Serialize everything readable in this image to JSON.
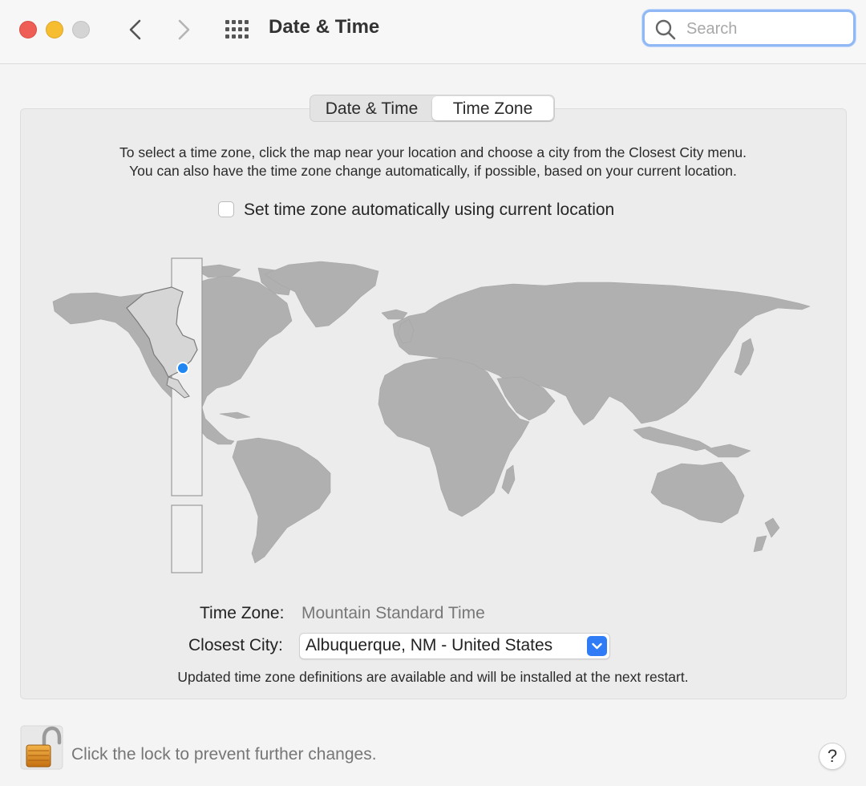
{
  "window": {
    "title": "Date & Time",
    "search_placeholder": "Search"
  },
  "tabs": [
    {
      "label": "Date & Time",
      "selected": false
    },
    {
      "label": "Time Zone",
      "selected": true
    }
  ],
  "instructions": {
    "line1": "To select a time zone, click the map near your location and choose a city from the Closest City menu.",
    "line2": "You can also have the time zone change automatically, if possible, based on your current location."
  },
  "auto_timezone": {
    "label": "Set time zone automatically using current location",
    "checked": false
  },
  "timezone": {
    "label": "Time Zone:",
    "value": "Mountain Standard Time"
  },
  "closest_city": {
    "label": "Closest City:",
    "value": "Albuquerque, NM - United States"
  },
  "update_note": "Updated time zone definitions are available and will be installed at the next restart.",
  "lock": {
    "text": "Click the lock to prevent further changes.",
    "state": "unlocked"
  },
  "help_label": "?",
  "colors": {
    "accent": "#2f7cf6",
    "land": "#b0b0b0",
    "selected_zone": "#d6d6d6",
    "location_dot": "#1f86f2"
  },
  "icons": {
    "back": "chevron-left-icon",
    "forward": "chevron-right-icon",
    "grid": "grid-icon",
    "search": "search-icon",
    "lock": "lock-open-icon",
    "popup": "chevron-down-icon"
  }
}
